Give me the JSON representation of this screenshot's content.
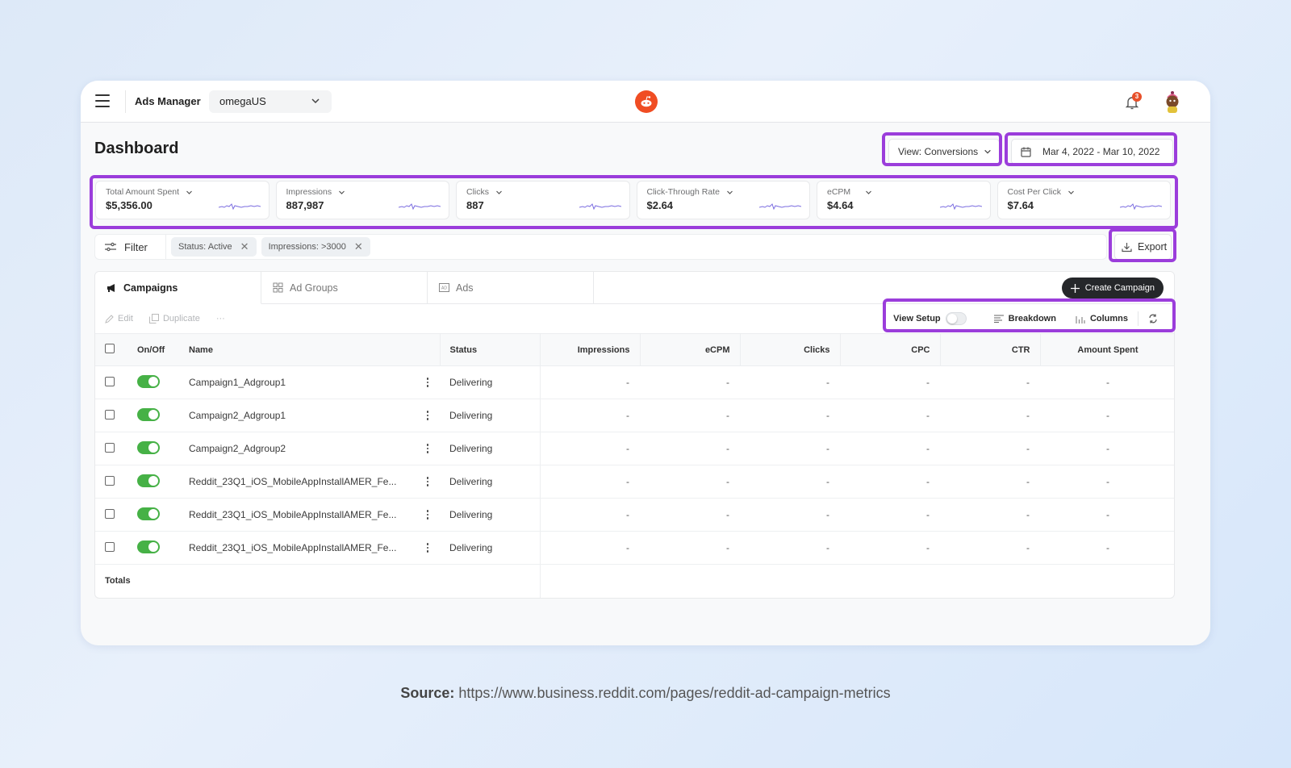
{
  "header": {
    "app_name": "Ads Manager",
    "account": "omegaUS",
    "notification_count": "3"
  },
  "page": {
    "title": "Dashboard",
    "view_selector": "View: Conversions",
    "date_range": "Mar 4, 2022 - Mar 10, 2022"
  },
  "metrics": [
    {
      "label": "Total Amount Spent",
      "value": "$5,356.00"
    },
    {
      "label": "Impressions",
      "value": "887,987"
    },
    {
      "label": "Clicks",
      "value": "887"
    },
    {
      "label": "Click-Through Rate",
      "value": "$2.64"
    },
    {
      "label": "eCPM",
      "value": "$4.64"
    },
    {
      "label": "Cost Per Click",
      "value": "$7.64"
    }
  ],
  "filters": {
    "filter_label": "Filter",
    "chips": [
      "Status: Active",
      "Impressions: >3000"
    ],
    "export_label": "Export"
  },
  "tabs": [
    {
      "label": "Campaigns",
      "icon": "megaphone-icon",
      "active": true
    },
    {
      "label": "Ad Groups",
      "icon": "grid-icon",
      "active": false
    },
    {
      "label": "Ads",
      "icon": "ad-icon",
      "active": false
    }
  ],
  "create_label": "Create Campaign",
  "actions": {
    "edit": "Edit",
    "duplicate": "Duplicate",
    "more": "···"
  },
  "view_setup": {
    "view_setup_label": "View Setup",
    "breakdown_label": "Breakdown",
    "columns_label": "Columns"
  },
  "table": {
    "columns": [
      "On/Off",
      "Name",
      "Status",
      "Impressions",
      "eCPM",
      "Clicks",
      "CPC",
      "CTR",
      "Amount Spent"
    ],
    "rows": [
      {
        "name": "Campaign1_Adgroup1",
        "status": "Delivering",
        "impressions": "-",
        "ecpm": "-",
        "clicks": "-",
        "cpc": "-",
        "ctr": "-",
        "amount_spent": "-"
      },
      {
        "name": "Campaign2_Adgroup1",
        "status": "Delivering",
        "impressions": "-",
        "ecpm": "-",
        "clicks": "-",
        "cpc": "-",
        "ctr": "-",
        "amount_spent": "-"
      },
      {
        "name": "Campaign2_Adgroup2",
        "status": "Delivering",
        "impressions": "-",
        "ecpm": "-",
        "clicks": "-",
        "cpc": "-",
        "ctr": "-",
        "amount_spent": "-"
      },
      {
        "name": "Reddit_23Q1_iOS_MobileAppInstallAMER_Fe...",
        "status": "Delivering",
        "impressions": "-",
        "ecpm": "-",
        "clicks": "-",
        "cpc": "-",
        "ctr": "-",
        "amount_spent": "-"
      },
      {
        "name": "Reddit_23Q1_iOS_MobileAppInstallAMER_Fe...",
        "status": "Delivering",
        "impressions": "-",
        "ecpm": "-",
        "clicks": "-",
        "cpc": "-",
        "ctr": "-",
        "amount_spent": "-"
      },
      {
        "name": "Reddit_23Q1_iOS_MobileAppInstallAMER_Fe...",
        "status": "Delivering",
        "impressions": "-",
        "ecpm": "-",
        "clicks": "-",
        "cpc": "-",
        "ctr": "-",
        "amount_spent": "-"
      }
    ],
    "totals_label": "Totals"
  },
  "source": {
    "label": "Source:",
    "url": "https://www.business.reddit.com/pages/reddit-ad-campaign-metrics"
  },
  "colors": {
    "highlight": "#9b3ddb",
    "toggle_on": "#46b146",
    "reddit_orange": "#f04d23",
    "create_button": "#25272a"
  }
}
